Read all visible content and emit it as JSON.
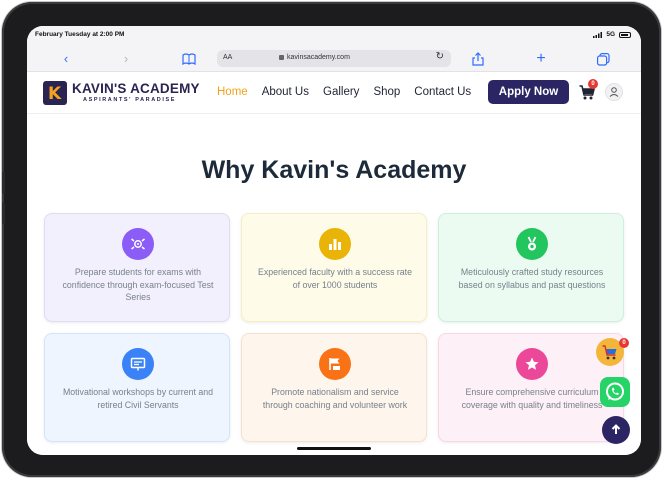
{
  "status": {
    "time": "February Tuesday at 2:00 PM",
    "network": "5G"
  },
  "safari": {
    "aa_label": "AA",
    "url": "kavinsacademy.com"
  },
  "site": {
    "logo_letter": "K",
    "logo_name": "KAVIN'S ACADEMY",
    "logo_tagline": "ASPIRANTS' PARADISE",
    "nav": [
      {
        "label": "Home",
        "active": true
      },
      {
        "label": "About Us",
        "active": false
      },
      {
        "label": "Gallery",
        "active": false
      },
      {
        "label": "Shop",
        "active": false
      },
      {
        "label": "Contact Us",
        "active": false
      }
    ],
    "apply_label": "Apply Now",
    "cart_count": "0",
    "float_cart_count": "0"
  },
  "section": {
    "title": "Why Kavin's Academy"
  },
  "cards": [
    {
      "text": "Prepare students for exams with confidence through exam-focused Test Series",
      "bg": "#f3f0fd",
      "border": "#e1dbf7",
      "icon_color": "#8b5cf6",
      "icon": "target-icon"
    },
    {
      "text": "Experienced faculty with a success rate of over 1000 students",
      "bg": "#fefbe8",
      "border": "#f6efc2",
      "icon_color": "#eab308",
      "icon": "bar-chart-icon"
    },
    {
      "text": "Meticulously crafted study resources based on syllabus and past questions",
      "bg": "#ecfbf2",
      "border": "#ccf0da",
      "icon_color": "#22c55e",
      "icon": "medal-icon"
    },
    {
      "text": "Motivational workshops by current and retired Civil Servants",
      "bg": "#eef5fe",
      "border": "#d3e5fb",
      "icon_color": "#3b82f6",
      "icon": "presentation-icon"
    },
    {
      "text": "Promote nationalism and service through coaching and volunteer work",
      "bg": "#fef5ec",
      "border": "#f8e1cc",
      "icon_color": "#f97316",
      "icon": "flag-icon"
    },
    {
      "text": "Ensure comprehensive curriculum coverage with quality and timeliness",
      "bg": "#fdf0f6",
      "border": "#f8d8e8",
      "icon_color": "#ec4899",
      "icon": "star-icon"
    }
  ]
}
